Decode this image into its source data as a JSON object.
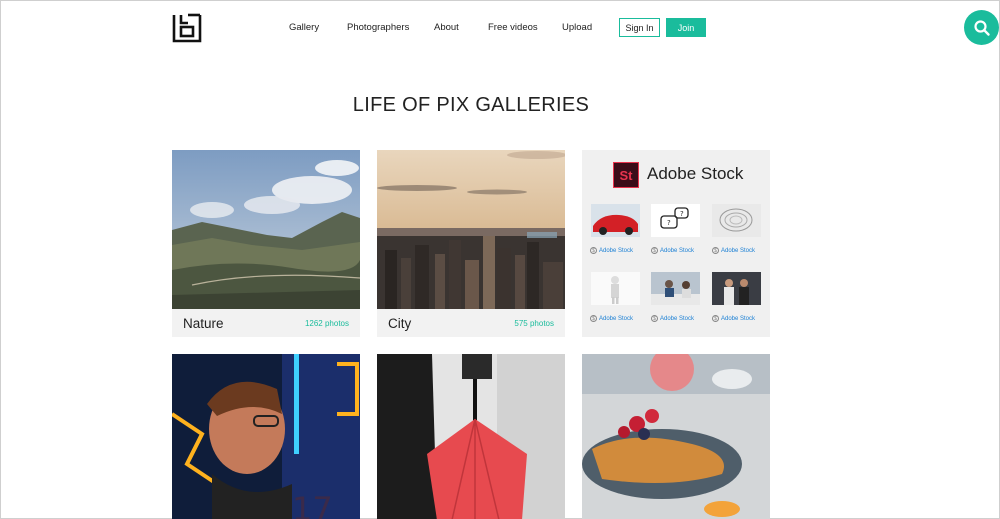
{
  "header": {
    "nav": [
      "Gallery",
      "Photographers",
      "About",
      "Free videos",
      "Upload"
    ],
    "signin_label": "Sign In",
    "join_label": "Join",
    "search_icon": "search-icon",
    "logo_icon": "life-of-pix-logo"
  },
  "page": {
    "title": "LIFE OF PIX GALLERIES"
  },
  "galleries": [
    {
      "name": "Nature",
      "count": "1262 photos"
    },
    {
      "name": "City",
      "count": "575 photos"
    }
  ],
  "ad": {
    "logo_text": "St",
    "title": "Adobe Stock",
    "thumb_label": "Adobe Stock"
  },
  "colors": {
    "accent": "#1abc9c",
    "adobe_red": "#e8344e"
  }
}
